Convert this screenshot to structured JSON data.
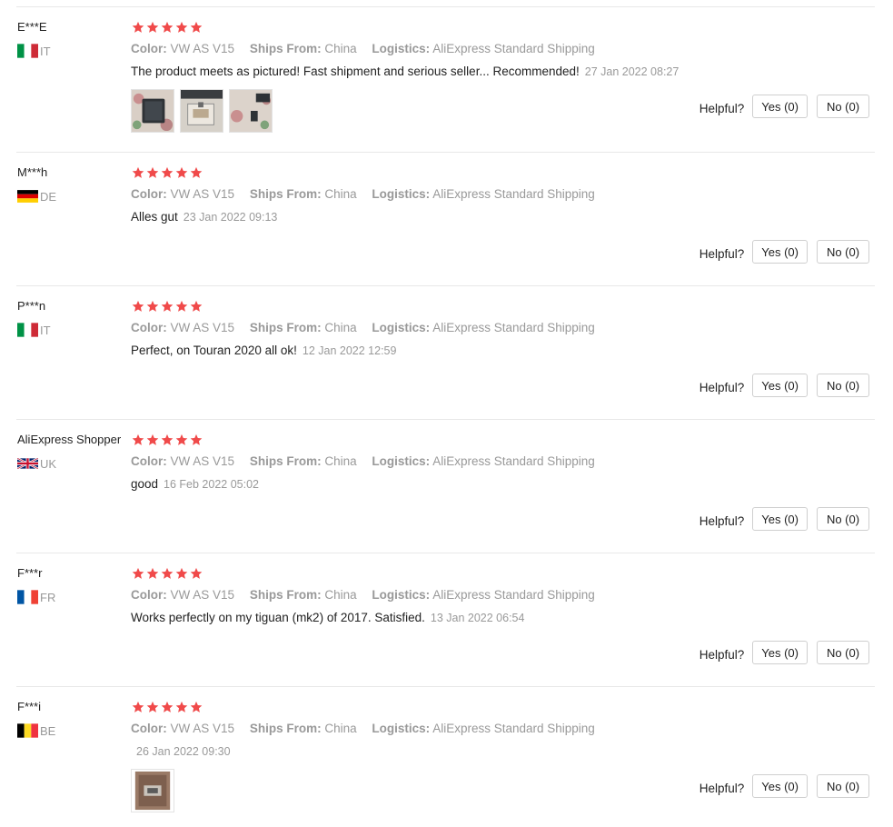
{
  "labels": {
    "color": "Color:",
    "ships_from": "Ships From:",
    "logistics": "Logistics:",
    "helpful": "Helpful?",
    "yes": "Yes (0)",
    "no": "No (0)"
  },
  "colors": {
    "star": "#f04a4a",
    "muted_text": "#999999",
    "divider": "#e8e8e8"
  },
  "reviews": [
    {
      "user": "E***E",
      "country": "IT",
      "flag_icon": "italy-flag-icon",
      "rating": 5,
      "color": "VW AS V15",
      "ships_from": "China",
      "logistics": "AliExpress Standard Shipping",
      "text": "The product meets as pictured! Fast shipment and serious seller... Recommended!",
      "date": "27 Jan 2022 08:27",
      "photo_count": 3
    },
    {
      "user": "M***h",
      "country": "DE",
      "flag_icon": "germany-flag-icon",
      "rating": 5,
      "color": "VW AS V15",
      "ships_from": "China",
      "logistics": "AliExpress Standard Shipping",
      "text": "Alles gut",
      "date": "23 Jan 2022 09:13",
      "photo_count": 0
    },
    {
      "user": "P***n",
      "country": "IT",
      "flag_icon": "italy-flag-icon",
      "rating": 5,
      "color": "VW AS V15",
      "ships_from": "China",
      "logistics": "AliExpress Standard Shipping",
      "text": "Perfect, on Touran 2020 all ok!",
      "date": "12 Jan 2022 12:59",
      "photo_count": 0
    },
    {
      "user": "AliExpress Shopper",
      "country": "UK",
      "flag_icon": "uk-flag-icon",
      "rating": 5,
      "color": "VW AS V15",
      "ships_from": "China",
      "logistics": "AliExpress Standard Shipping",
      "text": "good",
      "date": "16 Feb 2022 05:02",
      "photo_count": 0
    },
    {
      "user": "F***r",
      "country": "FR",
      "flag_icon": "france-flag-icon",
      "rating": 5,
      "color": "VW AS V15",
      "ships_from": "China",
      "logistics": "AliExpress Standard Shipping",
      "text": "Works perfectly on my tiguan (mk2) of 2017. Satisfied.",
      "date": "13 Jan 2022 06:54",
      "photo_count": 0
    },
    {
      "user": "F***i",
      "country": "BE",
      "flag_icon": "belgium-flag-icon",
      "rating": 5,
      "color": "VW AS V15",
      "ships_from": "China",
      "logistics": "AliExpress Standard Shipping",
      "text": "",
      "date": "26 Jan 2022 09:30",
      "photo_count": 1
    }
  ]
}
